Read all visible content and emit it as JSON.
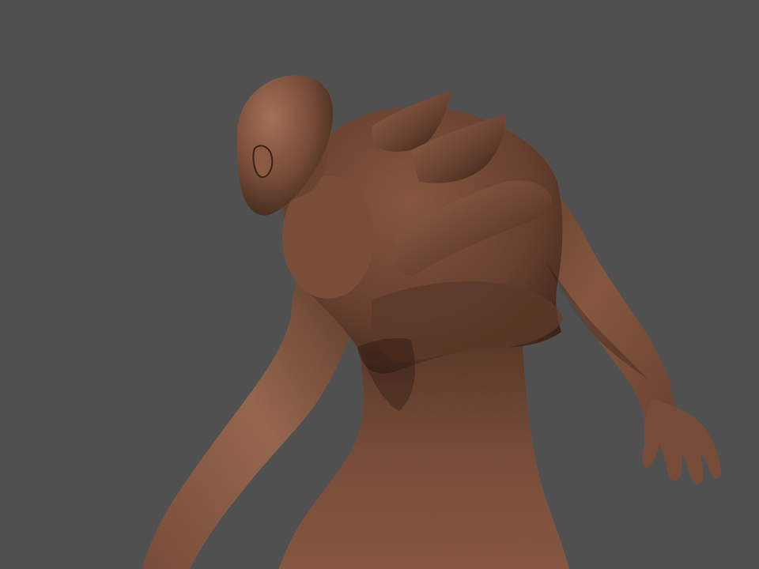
{
  "scene": {
    "background_color": "#505050",
    "subject": "sculpted-creature-render",
    "skin_colors": {
      "base": "#7a4e3a",
      "highlight": "#a87458",
      "shadow": "#3a2418",
      "deep_shadow": "#24150e"
    }
  }
}
